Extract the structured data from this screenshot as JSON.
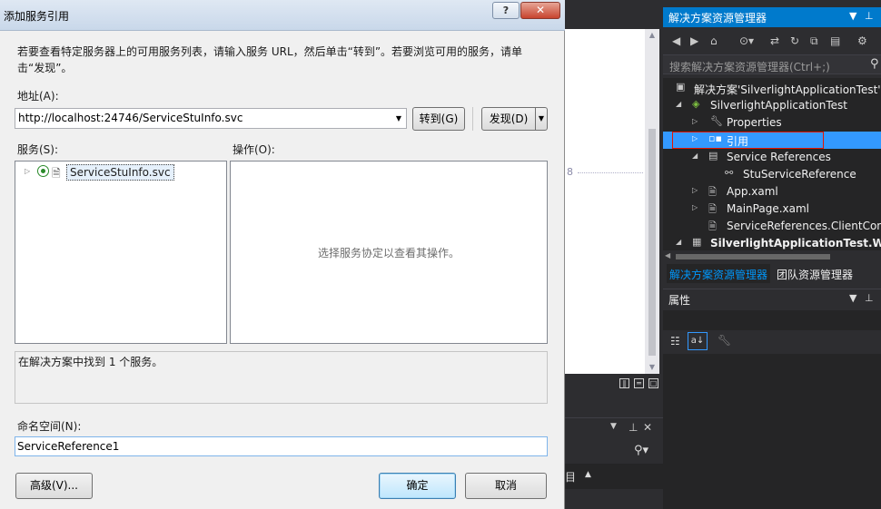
{
  "dialog": {
    "title": "添加服务引用",
    "help_label": "?",
    "close_label": "✕",
    "instructions": "若要查看特定服务器上的可用服务列表，请输入服务 URL，然后单击“转到”。若要浏览可用的服务，请单击“发现”。",
    "address_label": "地址(A):",
    "address_value": "http://localhost:24746/ServiceStuInfo.svc",
    "goto_label": "转到(G)",
    "discover_label": "发现(D)",
    "services_label": "服务(S):",
    "operations_label": "操作(O):",
    "service_items": [
      "ServiceStuInfo.svc"
    ],
    "operations_placeholder": "选择服务协定以查看其操作。",
    "status_text": "在解决方案中找到 1 个服务。",
    "namespace_label": "命名空间(N):",
    "namespace_value": "ServiceReference1",
    "advanced_label": "高级(V)...",
    "ok_label": "确定",
    "cancel_label": "取消"
  },
  "solution_explorer": {
    "title": "解决方案资源管理器",
    "search_placeholder": "搜索解决方案资源管理器(Ctrl+;)",
    "tree": [
      {
        "label": "解决方案'SilverlightApplicationTest'（"
      },
      {
        "label": "SilverlightApplicationTest"
      },
      {
        "label": "Properties"
      },
      {
        "label": "引用"
      },
      {
        "label": "Service References"
      },
      {
        "label": "StuServiceReference"
      },
      {
        "label": "App.xaml"
      },
      {
        "label": "MainPage.xaml"
      },
      {
        "label": "ServiceReferences.ClientConfi"
      },
      {
        "label": "SilverlightApplicationTest.Web"
      }
    ],
    "tab_active": "解决方案资源管理器",
    "tab_team": "团队资源管理器",
    "properties_title": "属性"
  },
  "editor": {
    "margin_mark": "8"
  },
  "lower_panel": {
    "tab_fragment": "目"
  },
  "colors": {
    "accent": "#007acc",
    "selection": "#3399ff",
    "highlight_outline": "#e51400"
  }
}
